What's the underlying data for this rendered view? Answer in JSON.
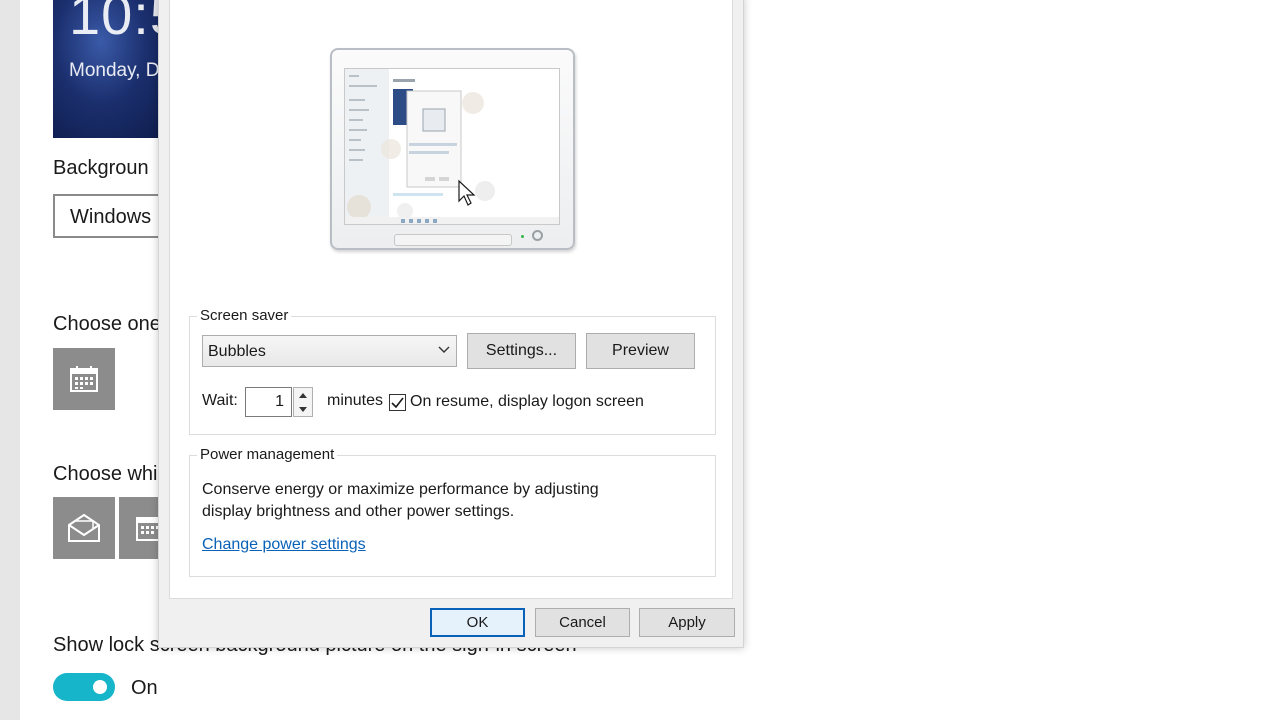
{
  "background_page": {
    "lock_time": "10:5",
    "lock_date": "Monday, D",
    "background_label": "Backgroun",
    "background_value": "Windows",
    "choose_one_label": "Choose one",
    "choose_which_label": "Choose whi",
    "show_lock_label": "Show lock screen background picture on the sign-in screen",
    "toggle_text": "On"
  },
  "dialog": {
    "screen_saver": {
      "group_title": "Screen saver",
      "selected": "Bubbles",
      "settings_button": "Settings...",
      "preview_button": "Preview",
      "wait_label": "Wait:",
      "wait_value": "1",
      "minutes_label": "minutes",
      "resume_checked": true,
      "resume_label": "On resume, display logon screen"
    },
    "power_management": {
      "group_title": "Power management",
      "description_line1": "Conserve energy or maximize performance by adjusting",
      "description_line2": "display brightness and other power settings.",
      "link_text": "Change power settings"
    },
    "buttons": {
      "ok": "OK",
      "cancel": "Cancel",
      "apply": "Apply"
    }
  },
  "colors": {
    "toggle_on": "#16b5c9",
    "link": "#0a62b8",
    "ok_border": "#0a62b8",
    "dialog_bg": "#f0f0f0"
  }
}
